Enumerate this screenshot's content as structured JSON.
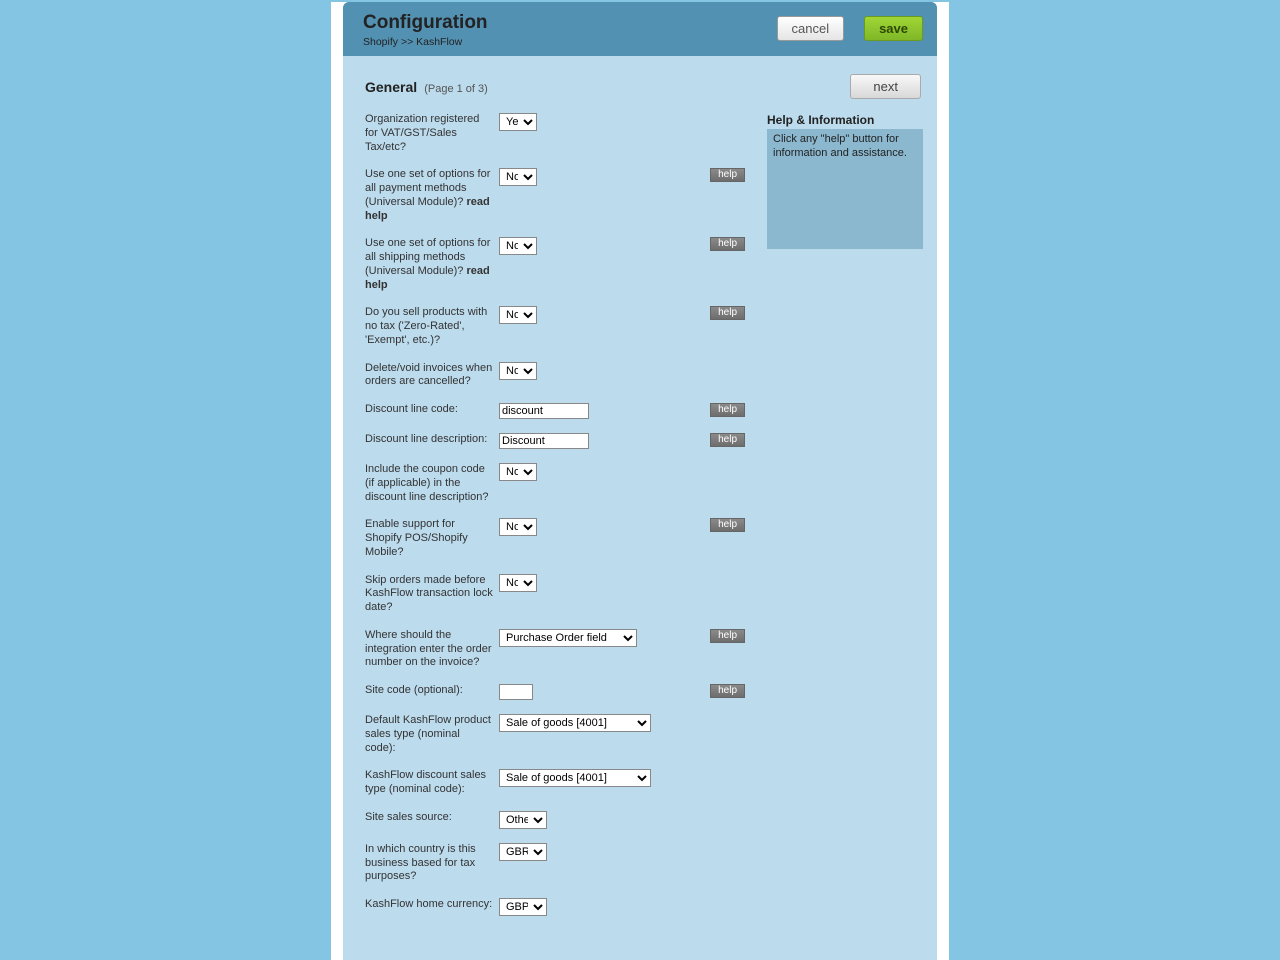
{
  "header": {
    "title": "Configuration",
    "breadcrumb": "Shopify >> KashFlow",
    "cancel_label": "cancel",
    "save_label": "save"
  },
  "section": {
    "title": "General",
    "subtitle": "(Page 1 of 3)",
    "next_label": "next"
  },
  "help": {
    "title": "Help & Information",
    "text": "Click any \"help\" button for information and assistance.",
    "btn_label": "help"
  },
  "readhelp": "read help",
  "options": {
    "yesno": [
      "Yes",
      "No"
    ],
    "ordernum_field": [
      "Purchase Order field"
    ],
    "nominal": [
      "Sale of goods [4001]"
    ],
    "source": [
      "Other"
    ],
    "country": [
      "GBR"
    ],
    "currency": [
      "GBP"
    ]
  },
  "fields": {
    "vat": {
      "label": "Organization registered for VAT/GST/Sales Tax/etc?",
      "value": "Yes"
    },
    "payment_universal": {
      "label_pre": "Use one set of options for all payment methods (Universal Module)? ",
      "value": "No"
    },
    "shipping_universal": {
      "label_pre": "Use one set of options for all shipping methods (Universal Module)? ",
      "value": "No"
    },
    "zero_tax": {
      "label": "Do you sell products with no tax ('Zero-Rated', 'Exempt', etc.)?",
      "value": "No"
    },
    "delete_void": {
      "label": "Delete/void invoices when orders are cancelled?",
      "value": "No"
    },
    "discount_code": {
      "label": "Discount line code:",
      "value": "discount"
    },
    "discount_desc": {
      "label": "Discount line description:",
      "value": "Discount"
    },
    "include_coupon": {
      "label": "Include the coupon code (if applicable) in the discount line description?",
      "value": "No"
    },
    "pos_support": {
      "label": "Enable support for Shopify POS/Shopify Mobile?",
      "value": "No"
    },
    "skip_lock": {
      "label": "Skip orders made before KashFlow transaction lock date?",
      "value": "No"
    },
    "order_number_loc": {
      "label": "Where should the integration enter the order number on the invoice?",
      "value": "Purchase Order field"
    },
    "site_code": {
      "label": "Site code (optional):",
      "value": ""
    },
    "default_nominal": {
      "label": "Default KashFlow product sales type (nominal code):",
      "value": "Sale of goods [4001]"
    },
    "discount_nominal": {
      "label": "KashFlow discount sales type (nominal code):",
      "value": "Sale of goods [4001]"
    },
    "sales_source": {
      "label": "Site sales source:",
      "value": "Other"
    },
    "country": {
      "label": "In which country is this business based for tax purposes?",
      "value": "GBR"
    },
    "home_currency": {
      "label": "KashFlow home currency:",
      "value": "GBP"
    }
  }
}
